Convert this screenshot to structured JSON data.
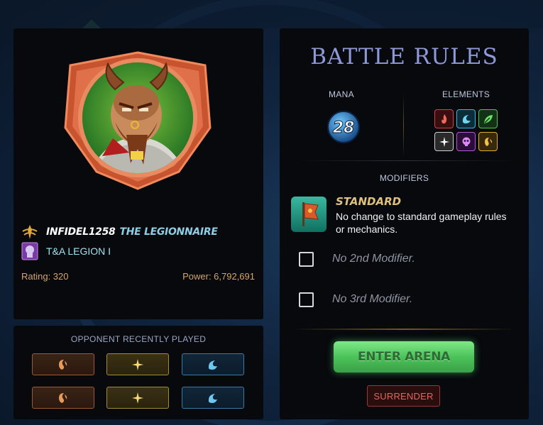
{
  "player": {
    "name": "INFIDEL1258",
    "title": "THE LEGIONNAIRE",
    "guild": "T&A LEGION I",
    "rating": "Rating: 320",
    "power": "Power: 6,792,691"
  },
  "opponent": {
    "title": "OPPONENT RECENTLY PLAYED",
    "recent": [
      [
        "death-element-icon",
        "life-element-icon",
        "water-element-icon"
      ],
      [
        "death-element-icon",
        "life-element-icon",
        "water-element-icon"
      ]
    ]
  },
  "rules": {
    "title": "BATTLE RULES",
    "mana_label": "MANA",
    "mana_value": "28",
    "elements_label": "ELEMENTS",
    "elements": [
      "fire",
      "water",
      "earth",
      "life",
      "death",
      "dragon"
    ],
    "modifiers_label": "MODIFIERS",
    "modifier_1_title": "STANDARD",
    "modifier_1_desc": "No change to standard gameplay rules or mechanics.",
    "modifier_2": "No 2nd Modifier.",
    "modifier_3": "No 3rd Modifier."
  },
  "actions": {
    "enter_arena": "ENTER ARENA",
    "surrender": "SURRENDER"
  },
  "colors": {
    "rules_title": "#8e9ad8",
    "stat_text": "#d3a56e",
    "enter_arena": "#5ccf6a",
    "surrender": "#d96a5f"
  }
}
